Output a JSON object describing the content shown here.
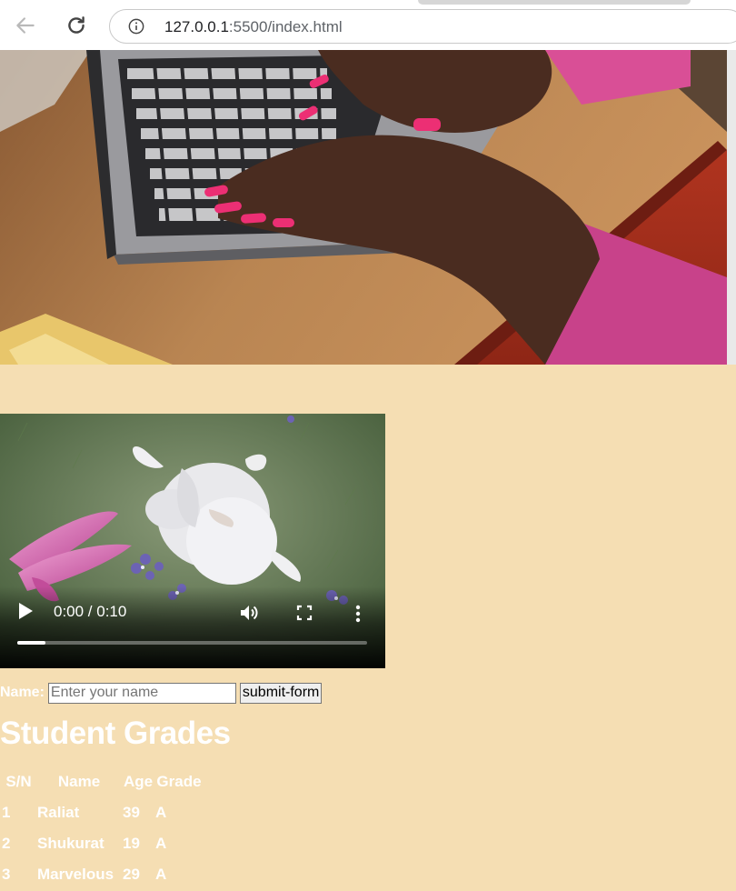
{
  "browser": {
    "url_host": "127.0.0.1",
    "url_path": ":5500/index.html"
  },
  "hero": {
    "alt": "Hands with pink nails typing on a laptop keyboard"
  },
  "video": {
    "time": "0:00 / 0:10",
    "progress": 0.08
  },
  "form": {
    "label": "Name:",
    "input_placeholder": "Enter your name",
    "input_value": "",
    "submit_label": "submit-form"
  },
  "grades": {
    "heading": "Student Grades",
    "columns": [
      "S/N",
      "Name",
      "Age",
      "Grade"
    ],
    "rows": [
      [
        "1",
        "Raliat",
        "39",
        "A"
      ],
      [
        "2",
        "Shukurat",
        "19",
        "A"
      ],
      [
        "3",
        "Marvelous",
        "29",
        "A"
      ]
    ]
  },
  "colors": {
    "page_background": "#f5deb3",
    "text": "#ffffff"
  }
}
